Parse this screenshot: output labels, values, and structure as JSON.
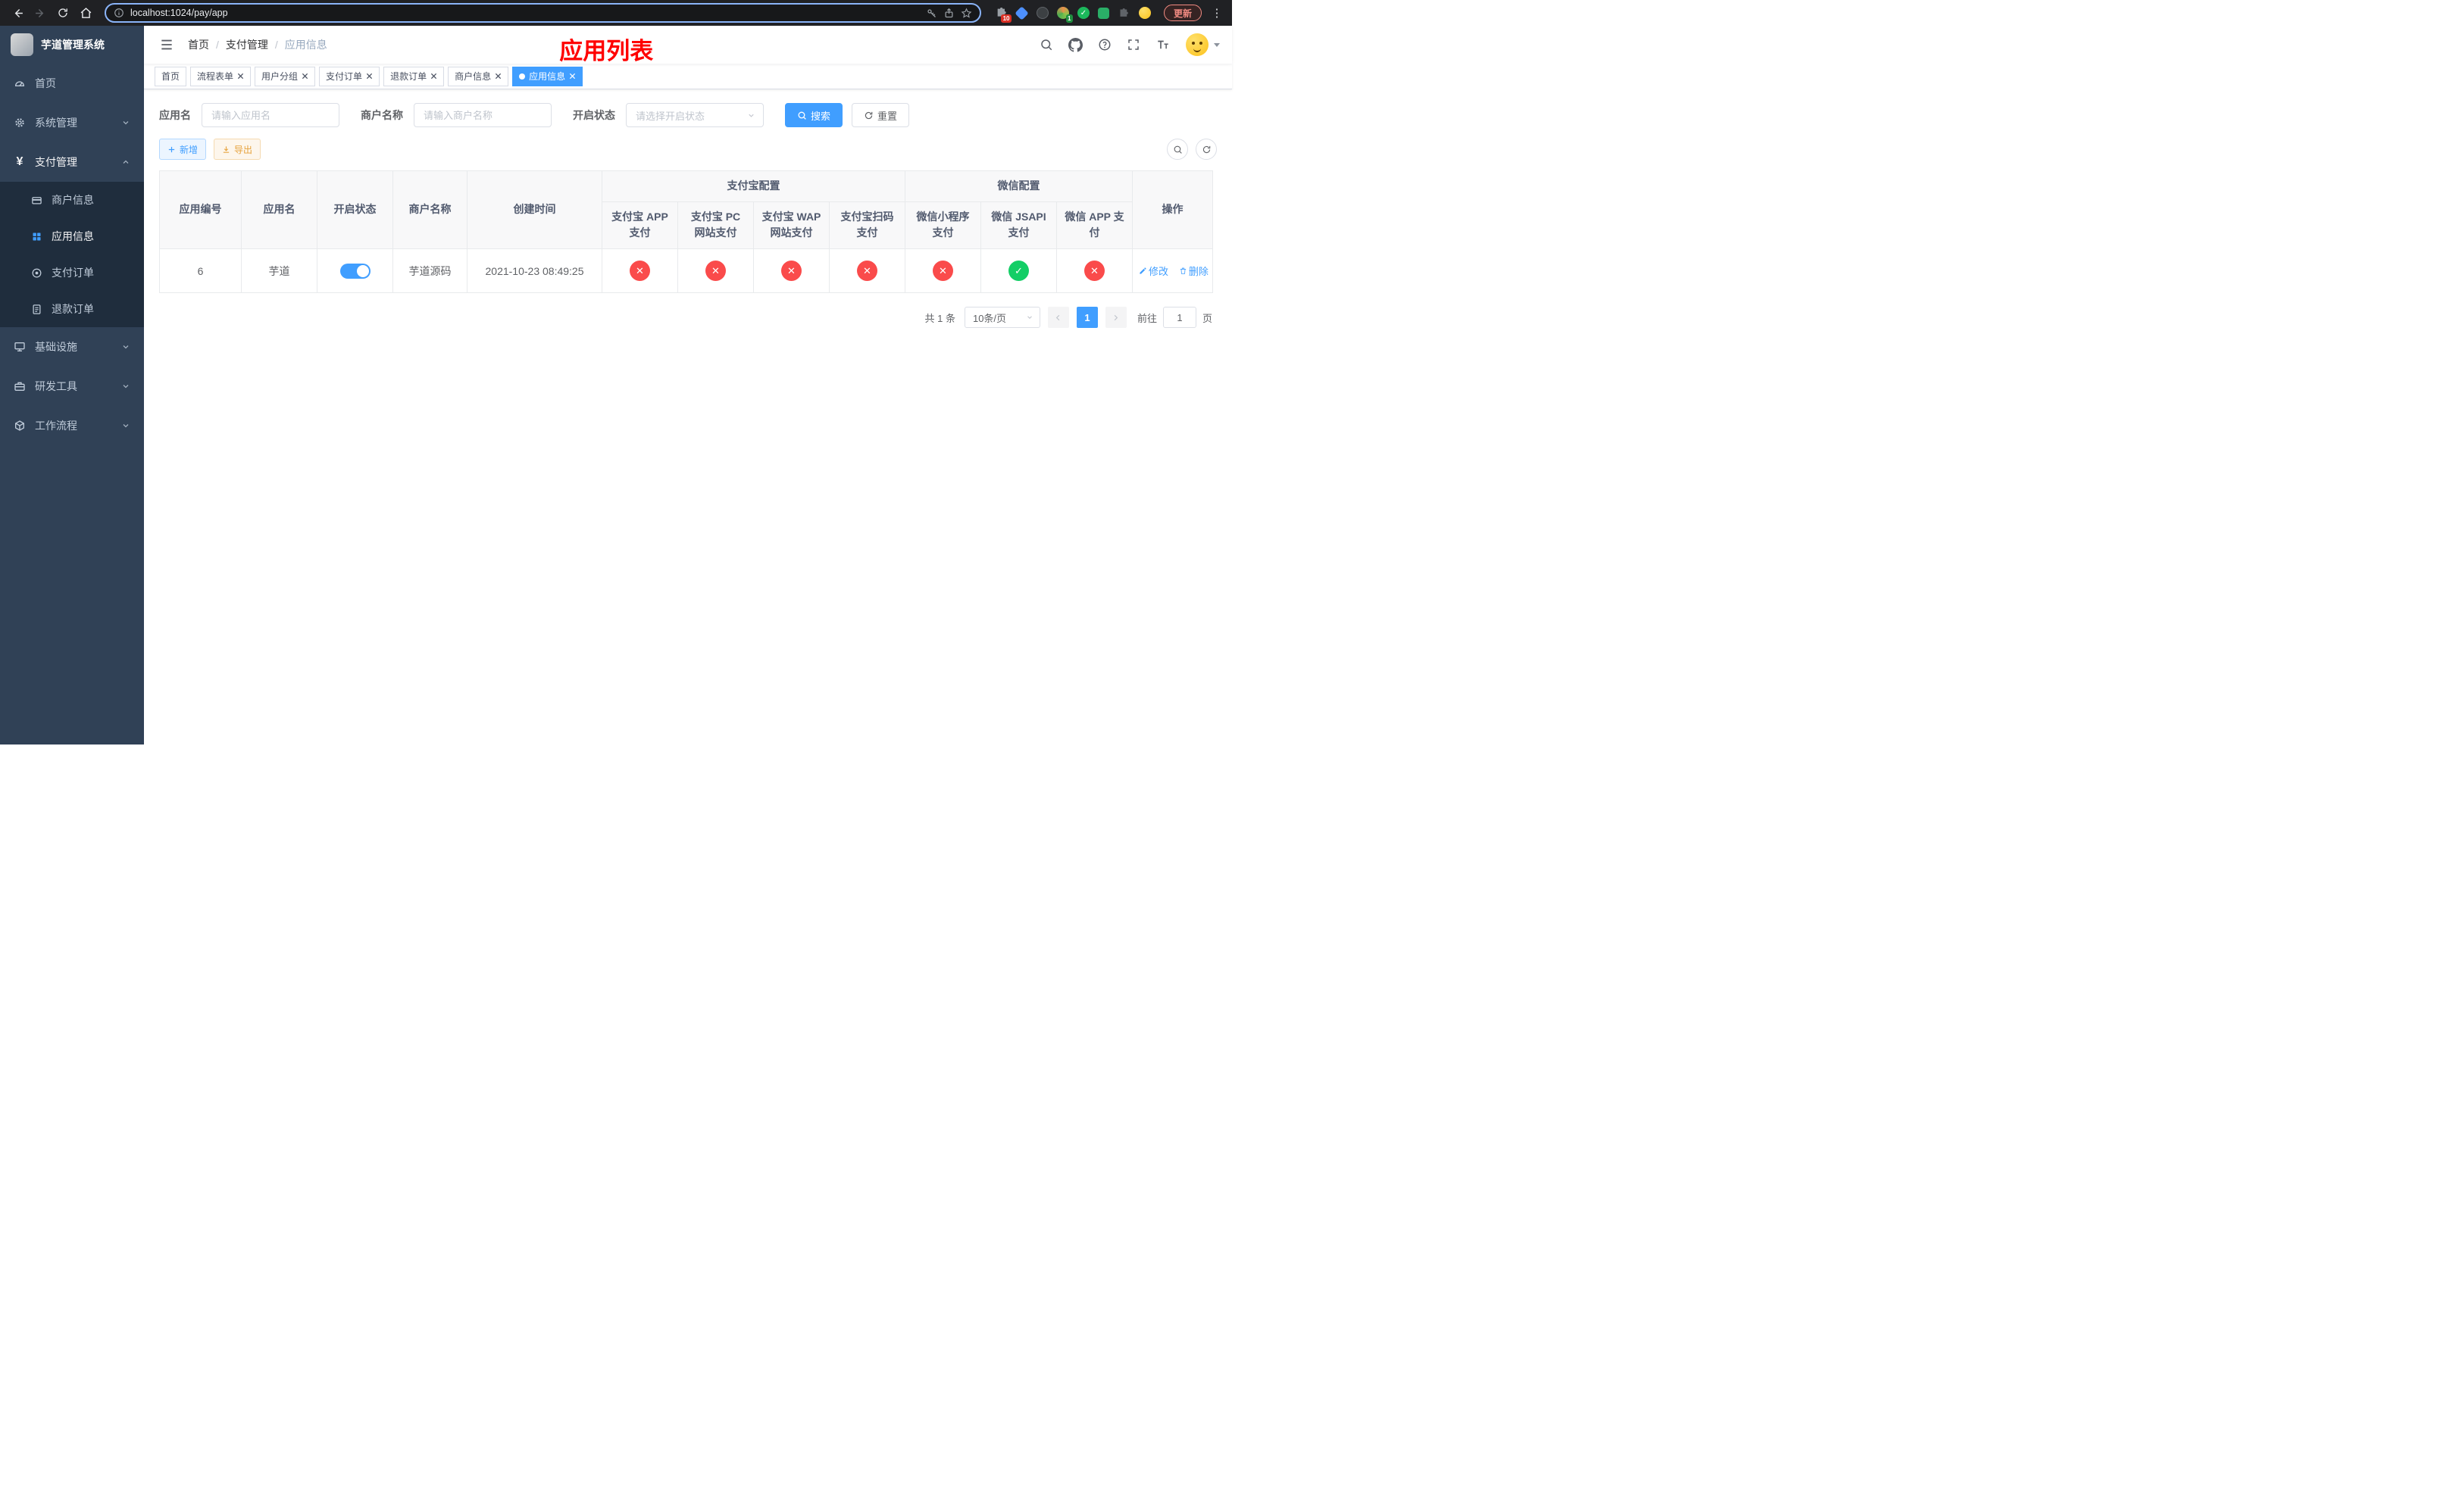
{
  "colors": {
    "accent": "#409EFF",
    "sidebar_bg": "#304156",
    "submenu_bg": "#1F2D3D",
    "status_off_red": "#FA4B4B",
    "status_on_green": "#13CE66",
    "warning": "#E6A23C",
    "annotation_red": "#FF0000"
  },
  "browser": {
    "url": "localhost:1024/pay/app",
    "update_label": "更新",
    "extensions_badge": "10",
    "profile_badge": "1"
  },
  "sidebar": {
    "title": "芋道管理系统",
    "items": [
      {
        "label": "首页"
      },
      {
        "label": "系统管理"
      },
      {
        "label": "支付管理",
        "children": [
          {
            "label": "商户信息"
          },
          {
            "label": "应用信息"
          },
          {
            "label": "支付订单"
          },
          {
            "label": "退款订单"
          }
        ]
      },
      {
        "label": "基础设施"
      },
      {
        "label": "研发工具"
      },
      {
        "label": "工作流程"
      }
    ]
  },
  "header": {
    "breadcrumb": [
      "首页",
      "支付管理",
      "应用信息"
    ],
    "overlay_title": "应用列表"
  },
  "tabs": [
    {
      "label": "首页"
    },
    {
      "label": "流程表单"
    },
    {
      "label": "用户分组"
    },
    {
      "label": "支付订单"
    },
    {
      "label": "退款订单"
    },
    {
      "label": "商户信息"
    },
    {
      "label": "应用信息"
    }
  ],
  "filters": {
    "app_name_label": "应用名",
    "app_name_placeholder": "请输入应用名",
    "merchant_label": "商户名称",
    "merchant_placeholder": "请输入商户名称",
    "status_label": "开启状态",
    "status_placeholder": "请选择开启状态",
    "search_label": "搜索",
    "reset_label": "重置"
  },
  "toolbar": {
    "add_label": "新增",
    "export_label": "导出"
  },
  "table": {
    "columns": {
      "app_id": "应用编号",
      "app_name": "应用名",
      "status": "开启状态",
      "merchant": "商户名称",
      "created": "创建时间",
      "alipay_group": "支付宝配置",
      "wechat_group": "微信配置",
      "alipay_app": "支付宝 APP 支付",
      "alipay_pc": "支付宝 PC 网站支付",
      "alipay_wap": "支付宝 WAP 网站支付",
      "alipay_qr": "支付宝扫码支付",
      "wx_mini": "微信小程序支付",
      "wx_jsapi": "微信 JSAPI 支付",
      "wx_app": "微信 APP 支付",
      "ops": "操作"
    },
    "rows": [
      {
        "app_id": "6",
        "app_name": "芋道",
        "status": "on",
        "merchant": "芋道源码",
        "created": "2021-10-23 08:49:25",
        "alipay_app": "off",
        "alipay_pc": "off",
        "alipay_wap": "off",
        "alipay_qr": "off",
        "wx_mini": "off",
        "wx_jsapi": "on",
        "wx_app": "off",
        "edit_label": "修改",
        "delete_label": "删除"
      }
    ]
  },
  "pagination": {
    "total": "共 1 条",
    "page_size": "10条/页",
    "page": "1",
    "goto_prefix": "前往",
    "goto_value": "1",
    "goto_suffix": "页"
  }
}
